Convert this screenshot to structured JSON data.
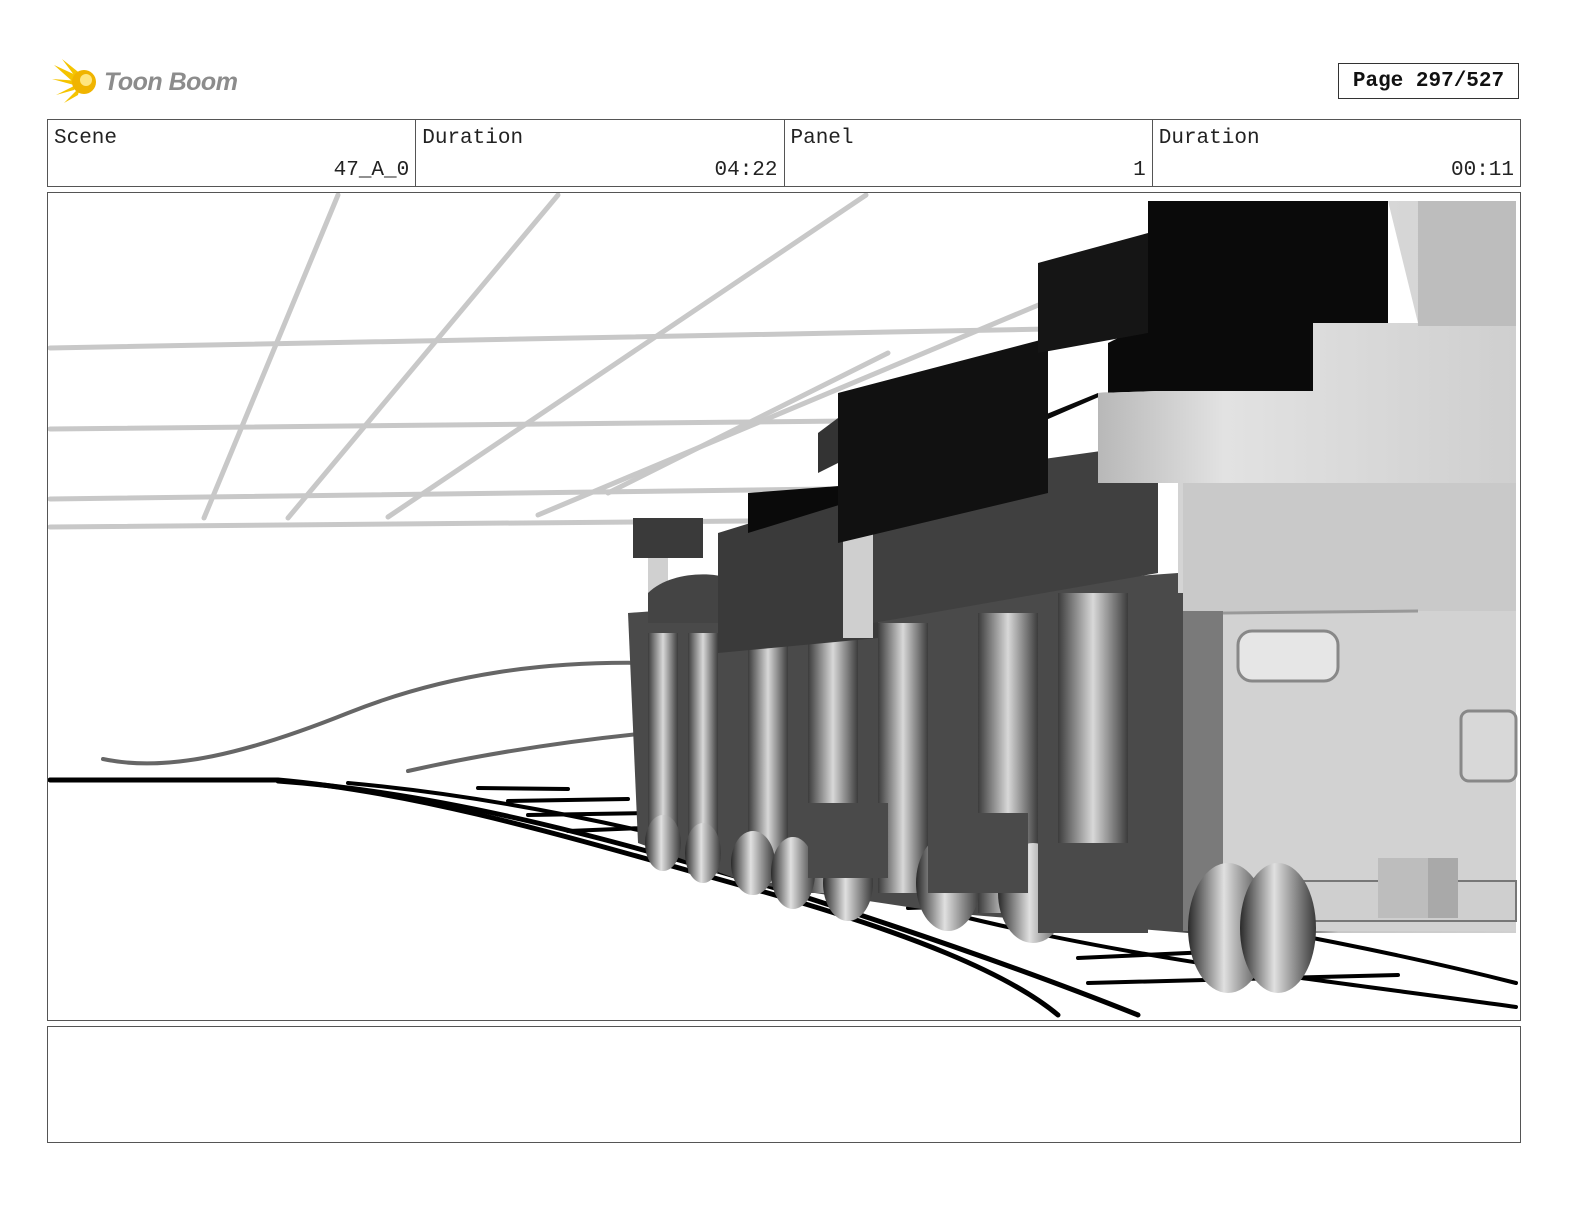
{
  "header": {
    "logo_text": "Toon Boom",
    "page_label": "Page 297/527"
  },
  "info": {
    "scene_label": "Scene",
    "scene_value": "47_A_0",
    "scene_duration_label": "Duration",
    "scene_duration_value": "04:22",
    "panel_label": "Panel",
    "panel_value": "1",
    "panel_duration_label": "Duration",
    "panel_duration_value": "00:11"
  },
  "notes": {
    "text": ""
  }
}
